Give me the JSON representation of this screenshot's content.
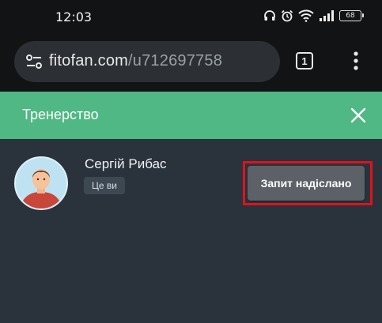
{
  "status_bar": {
    "time": "12:03",
    "battery_level": "68",
    "icons": [
      "headphones-icon",
      "alarm-icon",
      "wifi-icon",
      "signal-icon",
      "battery-icon"
    ]
  },
  "browser": {
    "url_domain": "fitofan.com",
    "url_path": "/u712697758",
    "tab_count": "1",
    "icons": [
      "site-settings-icon",
      "tab-switcher-icon",
      "more-vert-icon"
    ]
  },
  "header": {
    "title": "Тренерство",
    "close_icon": "close-icon",
    "background": "#4fb884"
  },
  "profile": {
    "name": "Сергій Рибас",
    "badge": "Це ви",
    "request_button_label": "Запит надіслано",
    "highlight_color": "#e0121c"
  }
}
